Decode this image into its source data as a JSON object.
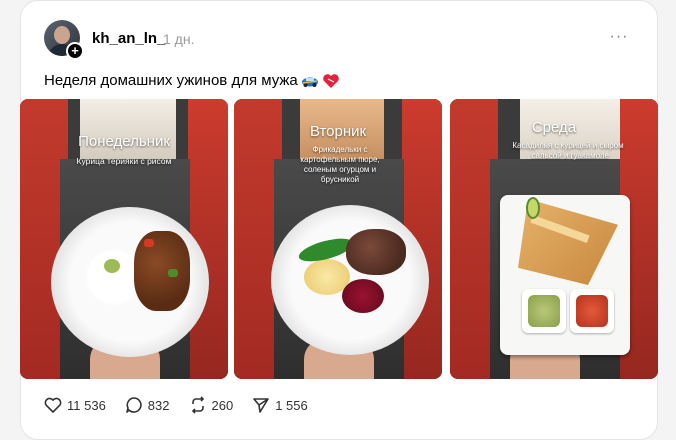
{
  "post": {
    "username": "kh_an_ln_",
    "time": "1 дн.",
    "text": "Неделя домашних ужинов для мужа",
    "more_label": "···"
  },
  "gallery": [
    {
      "day": "Понедельник",
      "dish": "Курица терияки с рисом"
    },
    {
      "day": "Вторник",
      "dish": "Фрикадельки с картофельным пюре, соленым огурцом и брусникой"
    },
    {
      "day": "Среда",
      "dish": "Касадилья с курицей и сыром , сальсой и гуакамоле"
    }
  ],
  "actions": {
    "likes": "11 536",
    "comments": "832",
    "reposts": "260",
    "shares": "1 556"
  },
  "icons": {
    "like": "heart-icon",
    "comment": "comment-icon",
    "repost": "repost-icon",
    "share": "send-icon",
    "more": "more-icon",
    "follow": "plus-icon"
  },
  "colors": {
    "wall": "#c33a2d",
    "muted": "#9a9a9a"
  }
}
